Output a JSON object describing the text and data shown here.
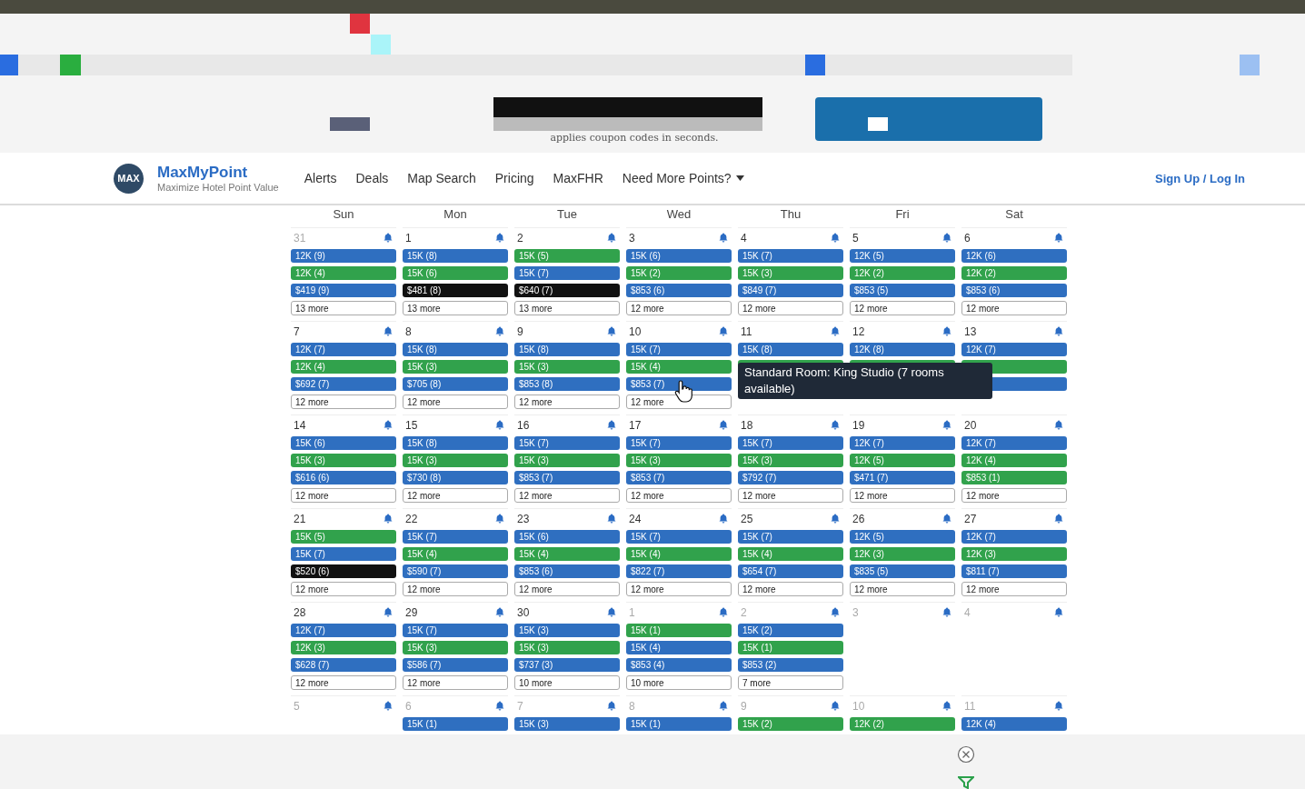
{
  "ad": {
    "tagline": "applies coupon codes in seconds."
  },
  "nav": {
    "logo_text": "MAX",
    "brand": "MaxMyPoint",
    "tagline": "Maximize Hotel Point Value",
    "links": [
      "Alerts",
      "Deals",
      "Map Search",
      "Pricing",
      "MaxFHR"
    ],
    "dropdown": "Need More Points?",
    "auth": "Sign Up / Log In"
  },
  "calendar": {
    "weekdays": [
      "Sun",
      "Mon",
      "Tue",
      "Wed",
      "Thu",
      "Fri",
      "Sat"
    ],
    "weeks": [
      [
        {
          "day": "31",
          "muted": true,
          "chips": [
            {
              "label": "12K (9)",
              "color": "#2f6fc0"
            },
            {
              "label": "12K (4)",
              "color": "#31a24c"
            },
            {
              "label": "$419 (9)",
              "color": "#2f6fc0"
            }
          ],
          "more": "13 more"
        },
        {
          "day": "1",
          "muted": false,
          "chips": [
            {
              "label": "15K (8)",
              "color": "#2f6fc0"
            },
            {
              "label": "15K (6)",
              "color": "#31a24c"
            },
            {
              "label": "$481 (8)",
              "color": "#111111"
            }
          ],
          "more": "13 more"
        },
        {
          "day": "2",
          "muted": false,
          "chips": [
            {
              "label": "15K (5)",
              "color": "#31a24c"
            },
            {
              "label": "15K (7)",
              "color": "#2f6fc0"
            },
            {
              "label": "$640 (7)",
              "color": "#111111"
            }
          ],
          "more": "13 more"
        },
        {
          "day": "3",
          "muted": false,
          "chips": [
            {
              "label": "15K (6)",
              "color": "#2f6fc0"
            },
            {
              "label": "15K (2)",
              "color": "#31a24c"
            },
            {
              "label": "$853 (6)",
              "color": "#2f6fc0"
            }
          ],
          "more": "12 more"
        },
        {
          "day": "4",
          "muted": false,
          "chips": [
            {
              "label": "15K (7)",
              "color": "#2f6fc0"
            },
            {
              "label": "15K (3)",
              "color": "#31a24c"
            },
            {
              "label": "$849 (7)",
              "color": "#2f6fc0"
            }
          ],
          "more": "12 more"
        },
        {
          "day": "5",
          "muted": false,
          "chips": [
            {
              "label": "12K (5)",
              "color": "#2f6fc0"
            },
            {
              "label": "12K (2)",
              "color": "#31a24c"
            },
            {
              "label": "$853 (5)",
              "color": "#2f6fc0"
            }
          ],
          "more": "12 more"
        },
        {
          "day": "6",
          "muted": false,
          "chips": [
            {
              "label": "12K (6)",
              "color": "#2f6fc0"
            },
            {
              "label": "12K (2)",
              "color": "#31a24c"
            },
            {
              "label": "$853 (6)",
              "color": "#2f6fc0"
            }
          ],
          "more": "12 more"
        }
      ],
      [
        {
          "day": "7",
          "muted": false,
          "chips": [
            {
              "label": "12K (7)",
              "color": "#2f6fc0"
            },
            {
              "label": "12K (4)",
              "color": "#31a24c"
            },
            {
              "label": "$692 (7)",
              "color": "#2f6fc0"
            }
          ],
          "more": "12 more"
        },
        {
          "day": "8",
          "muted": false,
          "chips": [
            {
              "label": "15K (8)",
              "color": "#2f6fc0"
            },
            {
              "label": "15K (3)",
              "color": "#31a24c"
            },
            {
              "label": "$705 (8)",
              "color": "#2f6fc0"
            }
          ],
          "more": "12 more"
        },
        {
          "day": "9",
          "muted": false,
          "chips": [
            {
              "label": "15K (8)",
              "color": "#2f6fc0"
            },
            {
              "label": "15K (3)",
              "color": "#31a24c"
            },
            {
              "label": "$853 (8)",
              "color": "#2f6fc0"
            }
          ],
          "more": "12 more"
        },
        {
          "day": "10",
          "muted": false,
          "chips": [
            {
              "label": "15K (7)",
              "color": "#2f6fc0"
            },
            {
              "label": "15K (4)",
              "color": "#31a24c"
            },
            {
              "label": "$853 (7)",
              "color": "#2f6fc0"
            }
          ],
          "more": "12 more"
        },
        {
          "day": "11",
          "muted": false,
          "chips": [
            {
              "label": "15K (8)",
              "color": "#2f6fc0"
            },
            {
              "color": "#31a24c"
            }
          ],
          "tooltip": "Standard Room: King Studio (7 rooms available)"
        },
        {
          "day": "12",
          "muted": false,
          "chips": [
            {
              "label": "12K (8)",
              "color": "#2f6fc0"
            },
            {
              "color": "#31a24c"
            }
          ]
        },
        {
          "day": "13",
          "muted": false,
          "chips": [
            {
              "label": "12K (7)",
              "color": "#2f6fc0"
            },
            {
              "color": "#31a24c"
            },
            {
              "color": "#2f6fc0"
            }
          ]
        }
      ],
      [
        {
          "day": "14",
          "muted": false,
          "chips": [
            {
              "label": "15K (6)",
              "color": "#2f6fc0"
            },
            {
              "label": "15K (3)",
              "color": "#31a24c"
            },
            {
              "label": "$616 (6)",
              "color": "#2f6fc0"
            }
          ],
          "more": "12 more"
        },
        {
          "day": "15",
          "muted": false,
          "chips": [
            {
              "label": "15K (8)",
              "color": "#2f6fc0"
            },
            {
              "label": "15K (3)",
              "color": "#31a24c"
            },
            {
              "label": "$730 (8)",
              "color": "#2f6fc0"
            }
          ],
          "more": "12 more"
        },
        {
          "day": "16",
          "muted": false,
          "chips": [
            {
              "label": "15K (7)",
              "color": "#2f6fc0"
            },
            {
              "label": "15K (3)",
              "color": "#31a24c"
            },
            {
              "label": "$853 (7)",
              "color": "#2f6fc0"
            }
          ],
          "more": "12 more"
        },
        {
          "day": "17",
          "muted": false,
          "chips": [
            {
              "label": "15K (7)",
              "color": "#2f6fc0"
            },
            {
              "label": "15K (3)",
              "color": "#31a24c"
            },
            {
              "label": "$853 (7)",
              "color": "#2f6fc0"
            }
          ],
          "more": "12 more"
        },
        {
          "day": "18",
          "muted": false,
          "chips": [
            {
              "label": "15K (7)",
              "color": "#2f6fc0"
            },
            {
              "label": "15K (3)",
              "color": "#31a24c"
            },
            {
              "label": "$792 (7)",
              "color": "#2f6fc0"
            }
          ],
          "more": "12 more"
        },
        {
          "day": "19",
          "muted": false,
          "chips": [
            {
              "label": "12K (7)",
              "color": "#2f6fc0"
            },
            {
              "label": "12K (5)",
              "color": "#31a24c"
            },
            {
              "label": "$471 (7)",
              "color": "#2f6fc0"
            }
          ],
          "more": "12 more"
        },
        {
          "day": "20",
          "muted": false,
          "chips": [
            {
              "label": "12K (7)",
              "color": "#2f6fc0"
            },
            {
              "label": "12K (4)",
              "color": "#31a24c"
            },
            {
              "label": "$853 (1)",
              "color": "#31a24c"
            }
          ],
          "more": "12 more"
        }
      ],
      [
        {
          "day": "21",
          "muted": false,
          "chips": [
            {
              "label": "15K (5)",
              "color": "#31a24c"
            },
            {
              "label": "15K (7)",
              "color": "#2f6fc0"
            },
            {
              "label": "$520 (6)",
              "color": "#111111"
            }
          ],
          "more": "12 more"
        },
        {
          "day": "22",
          "muted": false,
          "chips": [
            {
              "label": "15K (7)",
              "color": "#2f6fc0"
            },
            {
              "label": "15K (4)",
              "color": "#31a24c"
            },
            {
              "label": "$590 (7)",
              "color": "#2f6fc0"
            }
          ],
          "more": "12 more"
        },
        {
          "day": "23",
          "muted": false,
          "chips": [
            {
              "label": "15K (6)",
              "color": "#2f6fc0"
            },
            {
              "label": "15K (4)",
              "color": "#31a24c"
            },
            {
              "label": "$853 (6)",
              "color": "#2f6fc0"
            }
          ],
          "more": "12 more"
        },
        {
          "day": "24",
          "muted": false,
          "chips": [
            {
              "label": "15K (7)",
              "color": "#2f6fc0"
            },
            {
              "label": "15K (4)",
              "color": "#31a24c"
            },
            {
              "label": "$822 (7)",
              "color": "#2f6fc0"
            }
          ],
          "more": "12 more"
        },
        {
          "day": "25",
          "muted": false,
          "chips": [
            {
              "label": "15K (7)",
              "color": "#2f6fc0"
            },
            {
              "label": "15K (4)",
              "color": "#31a24c"
            },
            {
              "label": "$654 (7)",
              "color": "#2f6fc0"
            }
          ],
          "more": "12 more"
        },
        {
          "day": "26",
          "muted": false,
          "chips": [
            {
              "label": "12K (5)",
              "color": "#2f6fc0"
            },
            {
              "label": "12K (3)",
              "color": "#31a24c"
            },
            {
              "label": "$835 (5)",
              "color": "#2f6fc0"
            }
          ],
          "more": "12 more"
        },
        {
          "day": "27",
          "muted": false,
          "chips": [
            {
              "label": "12K (7)",
              "color": "#2f6fc0"
            },
            {
              "label": "12K (3)",
              "color": "#31a24c"
            },
            {
              "label": "$811 (7)",
              "color": "#2f6fc0"
            }
          ],
          "more": "12 more"
        }
      ],
      [
        {
          "day": "28",
          "muted": false,
          "chips": [
            {
              "label": "12K (7)",
              "color": "#2f6fc0"
            },
            {
              "label": "12K (3)",
              "color": "#31a24c"
            },
            {
              "label": "$628 (7)",
              "color": "#2f6fc0"
            }
          ],
          "more": "12 more"
        },
        {
          "day": "29",
          "muted": false,
          "chips": [
            {
              "label": "15K (7)",
              "color": "#2f6fc0"
            },
            {
              "label": "15K (3)",
              "color": "#31a24c"
            },
            {
              "label": "$586 (7)",
              "color": "#2f6fc0"
            }
          ],
          "more": "12 more"
        },
        {
          "day": "30",
          "muted": false,
          "chips": [
            {
              "label": "15K (3)",
              "color": "#2f6fc0"
            },
            {
              "label": "15K (3)",
              "color": "#31a24c"
            },
            {
              "label": "$737 (3)",
              "color": "#2f6fc0"
            }
          ],
          "more": "10 more"
        },
        {
          "day": "1",
          "muted": true,
          "chips": [
            {
              "label": "15K (1)",
              "color": "#31a24c"
            },
            {
              "label": "15K (4)",
              "color": "#2f6fc0"
            },
            {
              "label": "$853 (4)",
              "color": "#2f6fc0"
            }
          ],
          "more": "10 more"
        },
        {
          "day": "2",
          "muted": true,
          "chips": [
            {
              "label": "15K (2)",
              "color": "#2f6fc0"
            },
            {
              "label": "15K (1)",
              "color": "#31a24c"
            },
            {
              "label": "$853 (2)",
              "color": "#2f6fc0"
            }
          ],
          "more": "7 more"
        },
        {
          "day": "3",
          "muted": true
        },
        {
          "day": "4",
          "muted": true
        }
      ],
      [
        {
          "day": "5",
          "muted": true
        },
        {
          "day": "6",
          "muted": true,
          "chips": [
            {
              "label": "15K (1)",
              "color": "#2f6fc0"
            }
          ]
        },
        {
          "day": "7",
          "muted": true,
          "chips": [
            {
              "label": "15K (3)",
              "color": "#2f6fc0"
            }
          ]
        },
        {
          "day": "8",
          "muted": true,
          "chips": [
            {
              "label": "15K (1)",
              "color": "#2f6fc0"
            }
          ]
        },
        {
          "day": "9",
          "muted": true,
          "chips": [
            {
              "label": "15K (2)",
              "color": "#31a24c"
            }
          ]
        },
        {
          "day": "10",
          "muted": true,
          "chips": [
            {
              "label": "12K (2)",
              "color": "#31a24c"
            }
          ]
        },
        {
          "day": "11",
          "muted": true,
          "chips": [
            {
              "label": "12K (4)",
              "color": "#2f6fc0"
            }
          ]
        }
      ]
    ]
  }
}
